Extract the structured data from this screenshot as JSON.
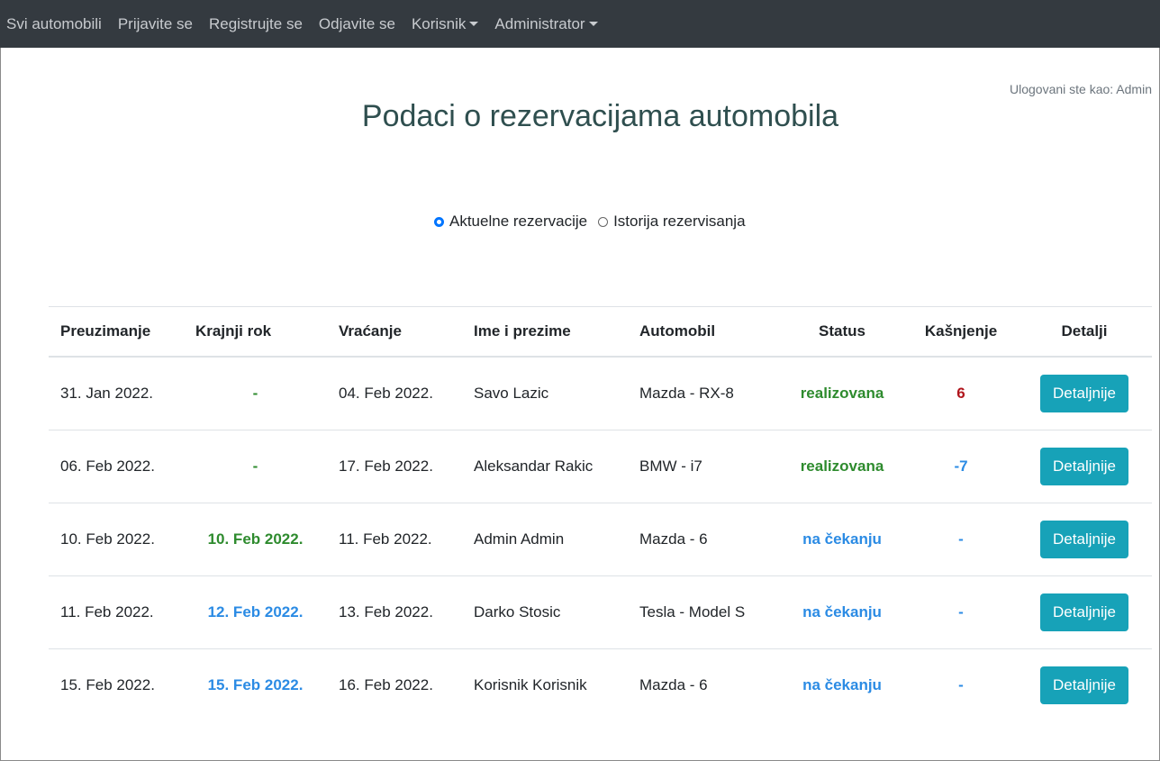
{
  "nav": {
    "items": [
      {
        "label": "Svi automobili"
      },
      {
        "label": "Prijavite se"
      },
      {
        "label": "Registrujte se"
      },
      {
        "label": "Odjavite se"
      },
      {
        "label": "Korisnik"
      },
      {
        "label": "Administrator"
      }
    ]
  },
  "logged_in": "Ulogovani ste kao: Admin",
  "title": "Podaci o rezervacijama automobila",
  "filter": {
    "options": [
      {
        "label": "Aktuelne rezervacije",
        "checked": true
      },
      {
        "label": "Istorija rezervisanja",
        "checked": false
      }
    ]
  },
  "table": {
    "headers": [
      "Preuzimanje",
      "Krajnji rok",
      "Vraćanje",
      "Ime i prezime",
      "Automobil",
      "Status",
      "Kašnjenje",
      "Detalji"
    ],
    "rows": [
      {
        "pickup": "31. Jan 2022.",
        "deadline": "-",
        "return": "04. Feb 2022.",
        "name": "Savo Lazic",
        "car": "Mazda - RX-8",
        "status": "realizovana",
        "delay": "6",
        "details": "Detaljnije"
      },
      {
        "pickup": "06. Feb 2022.",
        "deadline": "-",
        "return": "17. Feb 2022.",
        "name": "Aleksandar Rakic",
        "car": "BMW - i7",
        "status": "realizovana",
        "delay": "-7",
        "details": "Detaljnije"
      },
      {
        "pickup": "10. Feb 2022.",
        "deadline": "10. Feb 2022.",
        "return": "11. Feb 2022.",
        "name": "Admin Admin",
        "car": "Mazda - 6",
        "status": "na čekanju",
        "delay": "-",
        "details": "Detaljnije"
      },
      {
        "pickup": "11. Feb 2022.",
        "deadline": "12. Feb 2022.",
        "return": "13. Feb 2022.",
        "name": "Darko Stosic",
        "car": "Tesla - Model S",
        "status": "na čekanju",
        "delay": "-",
        "details": "Detaljnije"
      },
      {
        "pickup": "15. Feb 2022.",
        "deadline": "15. Feb 2022.",
        "return": "16. Feb 2022.",
        "name": "Korisnik Korisnik",
        "car": "Mazda - 6",
        "status": "na čekanju",
        "delay": "-",
        "details": "Detaljnije"
      }
    ]
  },
  "colors": {
    "navbar": "#343a40",
    "success": "#2e8b2e",
    "info": "#2b8be4",
    "danger": "#b0151c",
    "button": "#17a2b8"
  }
}
